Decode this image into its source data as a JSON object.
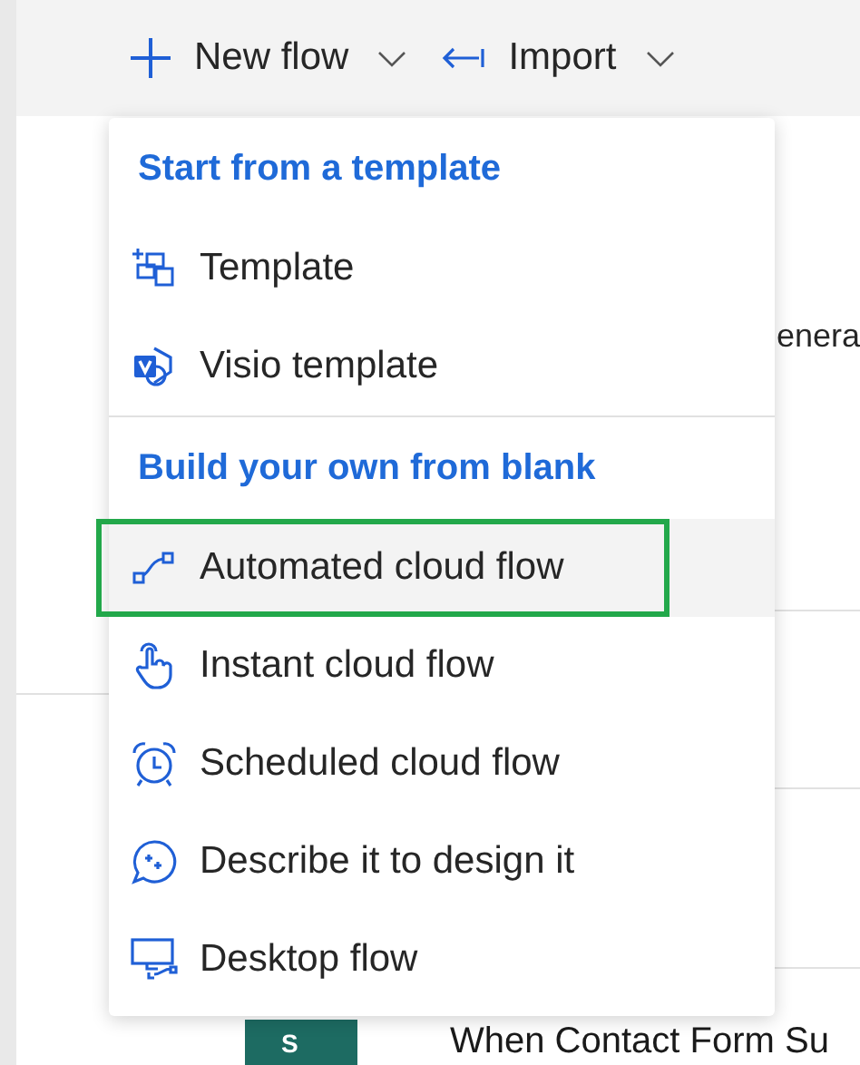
{
  "toolbar": [
    {
      "kind": "new",
      "label": "New flow"
    },
    {
      "kind": "import",
      "label": "Import"
    }
  ],
  "menu": {
    "sections": [
      {
        "header": "Start from a template",
        "items": [
          {
            "kind": "template",
            "label": "Template",
            "selected": false
          },
          {
            "kind": "visio",
            "label": "Visio template",
            "selected": false
          }
        ]
      },
      {
        "header": "Build your own from blank",
        "items": [
          {
            "kind": "automated",
            "label": "Automated cloud flow",
            "selected": true
          },
          {
            "kind": "instant",
            "label": "Instant cloud flow",
            "selected": false
          },
          {
            "kind": "scheduled",
            "label": "Scheduled cloud flow",
            "selected": false
          },
          {
            "kind": "describe",
            "label": "Describe it to design it",
            "selected": false
          },
          {
            "kind": "desktop",
            "label": "Desktop flow",
            "selected": false
          }
        ]
      }
    ]
  },
  "background": {
    "cut_text": "enera",
    "flow_row": {
      "badge": "S",
      "title": "When Contact Form Su"
    }
  }
}
